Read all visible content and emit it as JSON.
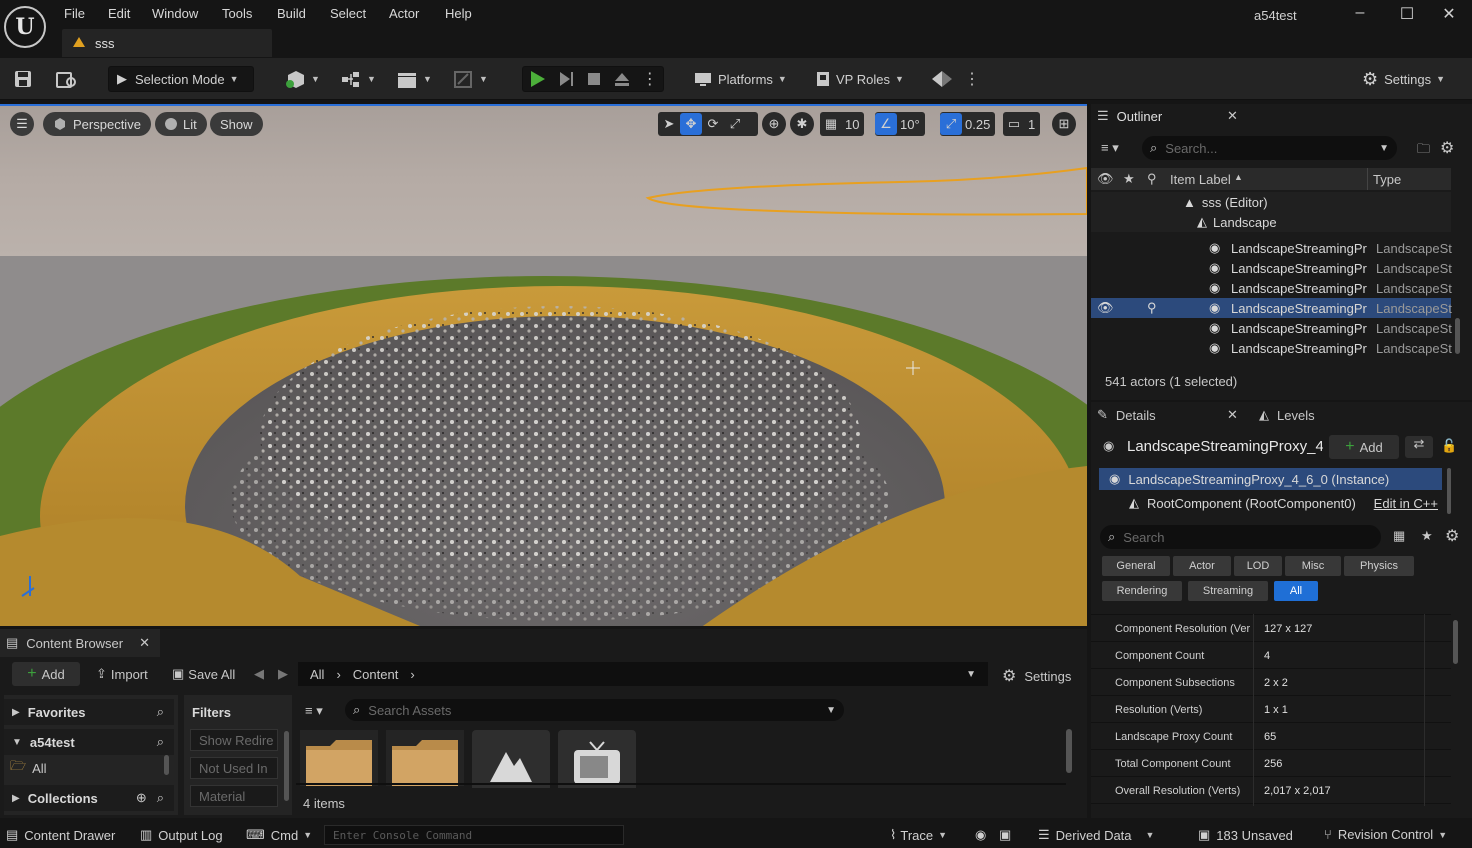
{
  "menu": [
    "File",
    "Edit",
    "Window",
    "Tools",
    "Build",
    "Select",
    "Actor",
    "Help"
  ],
  "level_tab": "sss",
  "window_title": "a54test",
  "toolbar": {
    "selection_mode": "Selection Mode",
    "platforms": "Platforms",
    "vp_roles": "VP Roles",
    "settings": "Settings"
  },
  "viewport": {
    "perspective": "Perspective",
    "lit": "Lit",
    "show": "Show",
    "grid_snap": "10",
    "rotation_snap": "10°",
    "scale_snap": "0.25",
    "camera_speed": "1"
  },
  "outliner": {
    "title": "Outliner",
    "search_placeholder": "Search...",
    "col_label": "Item Label",
    "col_type": "Type",
    "root": "sss (Editor)",
    "landscape": "Landscape",
    "rows": [
      {
        "label": "LandscapeStreamingPr",
        "type": "LandscapeSt"
      },
      {
        "label": "LandscapeStreamingPr",
        "type": "LandscapeSt"
      },
      {
        "label": "LandscapeStreamingPr",
        "type": "LandscapeSt"
      },
      {
        "label": "LandscapeStreamingPr",
        "type": "LandscapeSt"
      },
      {
        "label": "LandscapeStreamingPr",
        "type": "LandscapeSt"
      },
      {
        "label": "LandscapeStreamingPr",
        "type": "LandscapeSt"
      }
    ],
    "status": "541 actors (1 selected)"
  },
  "details": {
    "title": "Details",
    "levels_tab": "Levels",
    "actor_name": "LandscapeStreamingProxy_4",
    "add_label": "Add",
    "instance": "LandscapeStreamingProxy_4_6_0 (Instance)",
    "root_component": "RootComponent (RootComponent0)",
    "edit_cpp": "Edit in C++",
    "search_placeholder": "Search",
    "categories_row1": [
      "General",
      "Actor",
      "LOD",
      "Misc",
      "Physics"
    ],
    "categories_row2": [
      "Rendering",
      "Streaming",
      "All"
    ],
    "properties": [
      {
        "key": "Component Resolution (Ver",
        "value": "127 x 127"
      },
      {
        "key": "Component Count",
        "value": "4"
      },
      {
        "key": "Component Subsections",
        "value": "2 x 2"
      },
      {
        "key": "Resolution (Verts)",
        "value": "1 x 1"
      },
      {
        "key": "Landscape Proxy Count",
        "value": "65"
      },
      {
        "key": "Total Component Count",
        "value": "256"
      },
      {
        "key": "Overall Resolution (Verts)",
        "value": "2,017 x 2,017"
      }
    ]
  },
  "content_browser": {
    "title": "Content Browser",
    "add": "Add",
    "import": "Import",
    "save_all": "Save All",
    "path": [
      "All",
      "Content"
    ],
    "settings": "Settings",
    "favorites": "Favorites",
    "project": "a54test",
    "all": "All",
    "collections": "Collections",
    "filters": "Filters",
    "filter_items": [
      "Show Redire",
      "Not Used In",
      "Material"
    ],
    "search_placeholder": "Search Assets",
    "item_count": "4 items"
  },
  "statusbar": {
    "content_drawer": "Content Drawer",
    "output_log": "Output Log",
    "cmd": "Cmd",
    "console_placeholder": "Enter Console Command",
    "trace": "Trace",
    "derived_data": "Derived Data",
    "unsaved": "183 Unsaved",
    "revision_control": "Revision Control"
  }
}
